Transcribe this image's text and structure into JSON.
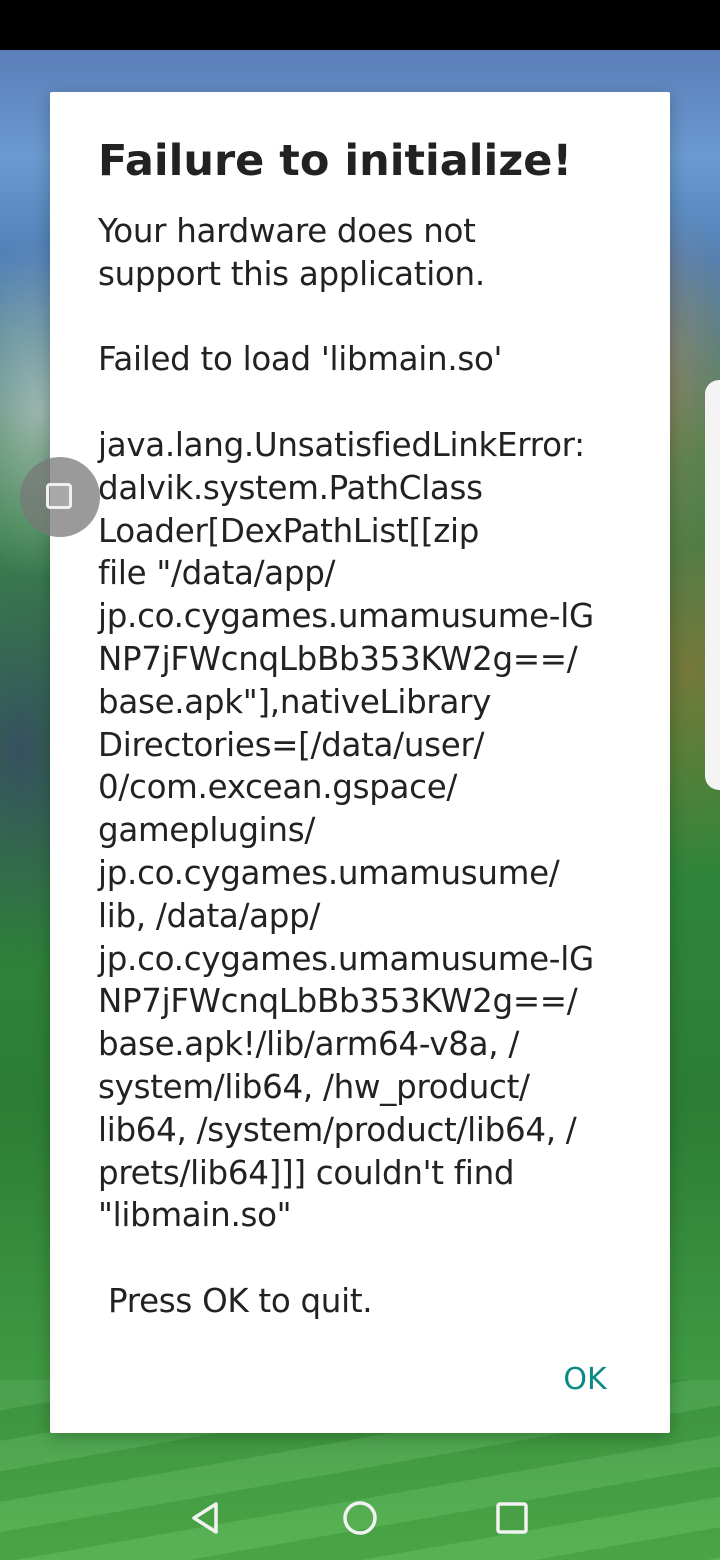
{
  "dialog": {
    "title": "Failure to initialize!",
    "message": "Your hardware does not\nsupport this application.\n\nFailed to load 'libmain.so'\n\njava.lang.UnsatisfiedLinkError:\ndalvik.system.PathClass\nLoader[DexPathList[[zip\nfile \"/data/app/\njp.co.cygames.umamusume-lG\nNP7jFWcnqLbBb353KW2g==/\nbase.apk\"],nativeLibrary\nDirectories=[/data/user/\n0/com.excean.gspace/\ngameplugins/\njp.co.cygames.umamusume/\nlib, /data/app/\njp.co.cygames.umamusume-lG\nNP7jFWcnqLbBb353KW2g==/\nbase.apk!/lib/arm64-v8a, /\nsystem/lib64, /hw_product/\nlib64, /system/product/lib64, /\nprets/lib64]]] couldn't find\n\"libmain.so\"\n\n Press OK to quit.",
    "ok_label": "OK",
    "accent_color": "#0a8a84"
  },
  "floating_button": {
    "icon": "square-icon"
  },
  "nav_bar": {
    "back_icon": "triangle-back-icon",
    "home_icon": "circle-home-icon",
    "recents_icon": "square-recents-icon"
  }
}
